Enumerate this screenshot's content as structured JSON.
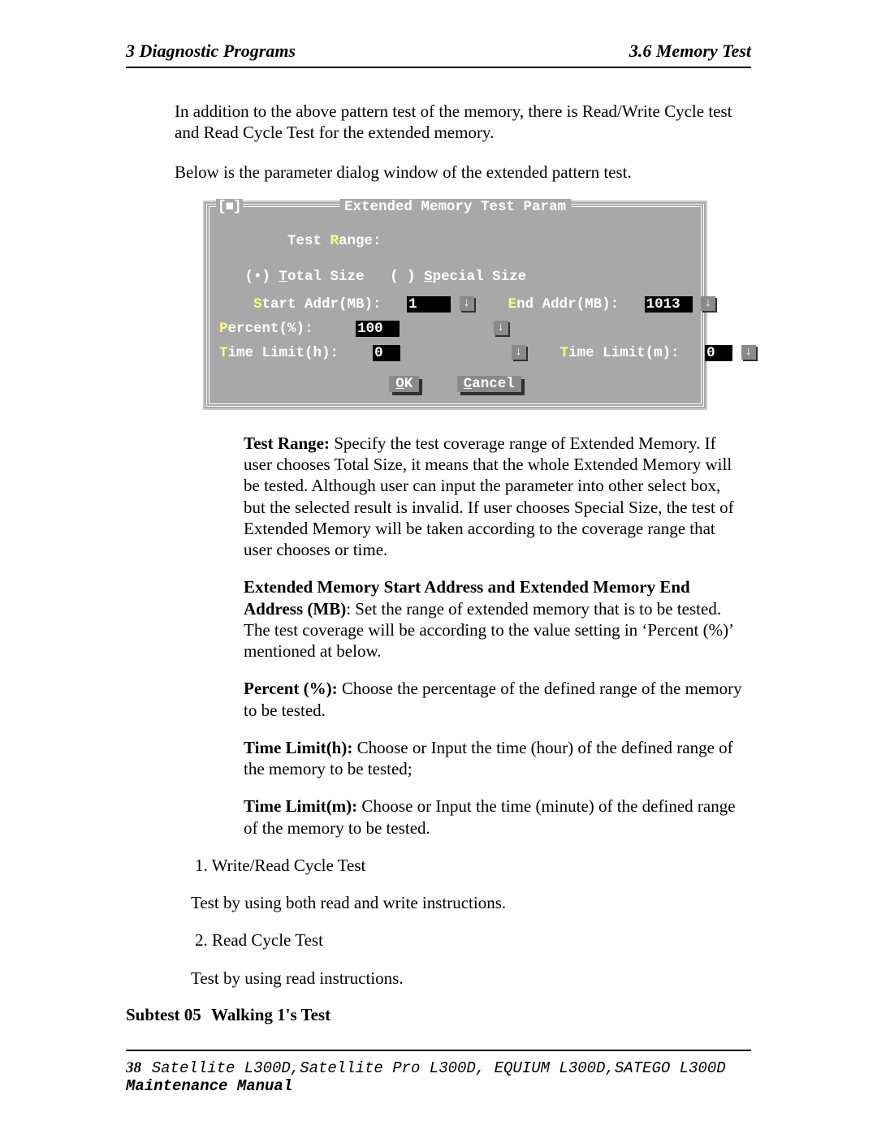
{
  "header": {
    "left": "3  Diagnostic Programs",
    "right": "3.6 Memory Test"
  },
  "intro": {
    "p1": "In addition to the above pattern test of the memory, there is Read/Write Cycle test and Read Cycle Test for the extended memory.",
    "p2": "Below is the parameter dialog window of the extended pattern test."
  },
  "dialog": {
    "title": "Extended Memory Test Param",
    "close_glyph": "[■]",
    "test_range_label": "Test ",
    "test_range_hotkey": "R",
    "test_range_rest": "ange:",
    "total_radio": "(•) ",
    "total_u": "T",
    "total_rest": "otal Size",
    "special_radio": "( ) ",
    "special_u": "S",
    "special_rest": "pecial Size",
    "start_hot": "S",
    "start_label": "tart Addr(MB):",
    "start_val": "1",
    "end_hot": "E",
    "end_label": "nd Addr(MB):",
    "end_val": "1013",
    "percent_hot": "P",
    "percent_label": "ercent(%):",
    "percent_val": "100",
    "tlh_hot": "T",
    "tlh_label": "ime Limit(h):",
    "tlh_val": "0",
    "tlm_hot": "T",
    "tlm_label": "ime Limit(m):",
    "tlm_val": "0",
    "ok": "OK",
    "cancel": "Cancel",
    "arrow": "↓"
  },
  "desc": {
    "range_b": "Test Range: ",
    "range_t": "Specify the test coverage range of Extended Memory. If user chooses Total Size, it means that the whole Extended Memory will be tested. Although user can input the parameter into other select box, but the selected result is invalid. If user chooses Special Size, the test of Extended Memory will be taken according to the coverage range that user chooses or time.",
    "addr_b": "Extended Memory Start Address and Extended Memory End Address (MB)",
    "addr_t": ": Set the range of extended memory that is to be tested. The test coverage will be according to the value setting in ‘Percent (%)’ mentioned at below.",
    "percent_b": "Percent (%): ",
    "percent_t": "Choose the percentage of the defined range of the memory to be tested.",
    "tlh_b": "Time Limit(h): ",
    "tlh_t": "Choose or Input the time (hour) of the defined range of the memory to be tested;",
    "tlm_b": "Time Limit(m): ",
    "tlm_t": "Choose or Input the time (minute) of the defined range of the memory to be tested."
  },
  "lists": {
    "l1_num": "1.  Write/Read Cycle Test",
    "l1_t": "Test by using both read and write instructions.",
    "l2_num": "2.  Read Cycle Test",
    "l2_t": "Test by using read instructions."
  },
  "subtest": {
    "num": "Subtest 05",
    "title": "Walking 1's Test"
  },
  "footer": {
    "page": "38",
    "models": "Satellite L300D,Satellite Pro L300D, EQUIUM L300D,SATEGO L300D ",
    "manual": "Maintenance Manual"
  }
}
